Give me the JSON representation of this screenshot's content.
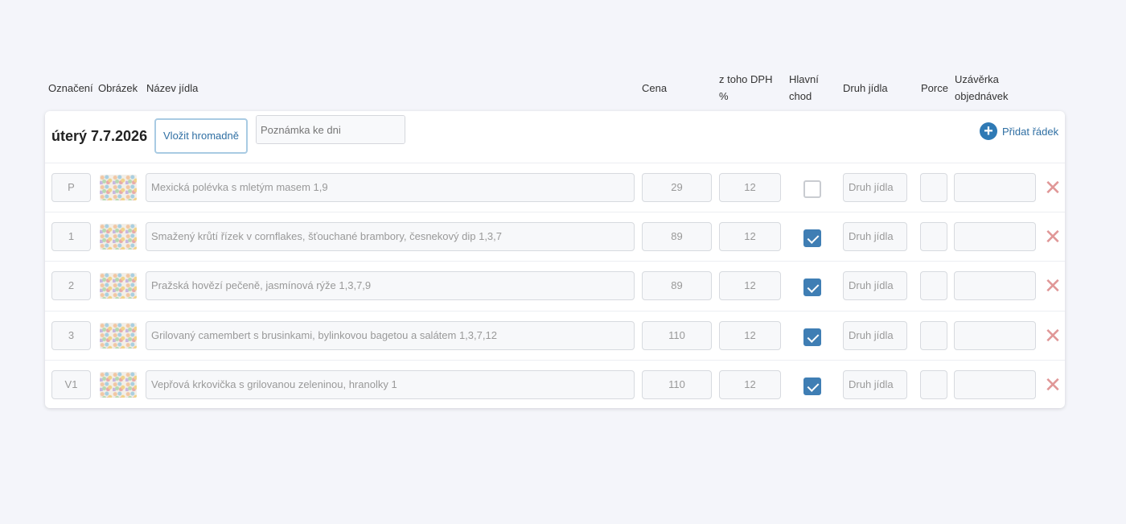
{
  "headers": {
    "oznaceni": "Označení",
    "obrazek": "Obrázek",
    "nazev": "Název jídla",
    "cena": "Cena",
    "dph_line1": "z toho DPH",
    "dph_line2": "%",
    "hlavni_line1": "Hlavní",
    "hlavni_line2": "chod",
    "druh": "Druh jídla",
    "porce": "Porce",
    "uzaverka_line1": "Uzávěrka",
    "uzaverka_line2": "objednávek"
  },
  "day": {
    "title": "úterý 7.7.2026",
    "bulk_button": "Vložit hromadně",
    "note_placeholder": "Poznámka ke dni",
    "add_row_label": "Přidat řádek"
  },
  "rows": [
    {
      "code": "P",
      "name": "Mexická polévka s mletým masem 1,9",
      "price": "29",
      "vat": "12",
      "main": false,
      "type_placeholder": "Druh jídla"
    },
    {
      "code": "1",
      "name": "Smažený krůtí řízek v cornflakes, šťouchané brambory, česnekový dip 1,3,7",
      "price": "89",
      "vat": "12",
      "main": true,
      "type_placeholder": "Druh jídla"
    },
    {
      "code": "2",
      "name": "Pražská hovězí pečeně, jasmínová rýže 1,3,7,9",
      "price": "89",
      "vat": "12",
      "main": true,
      "type_placeholder": "Druh jídla"
    },
    {
      "code": "3",
      "name": "Grilovaný camembert s brusinkami, bylinkovou bagetou a salátem 1,3,7,12",
      "price": "110",
      "vat": "12",
      "main": true,
      "type_placeholder": "Druh jídla"
    },
    {
      "code": "V1",
      "name": "Vepřová krkovička s grilovanou zeleninou, hranolky 1",
      "price": "110",
      "vat": "12",
      "main": true,
      "type_placeholder": "Druh jídla"
    }
  ]
}
